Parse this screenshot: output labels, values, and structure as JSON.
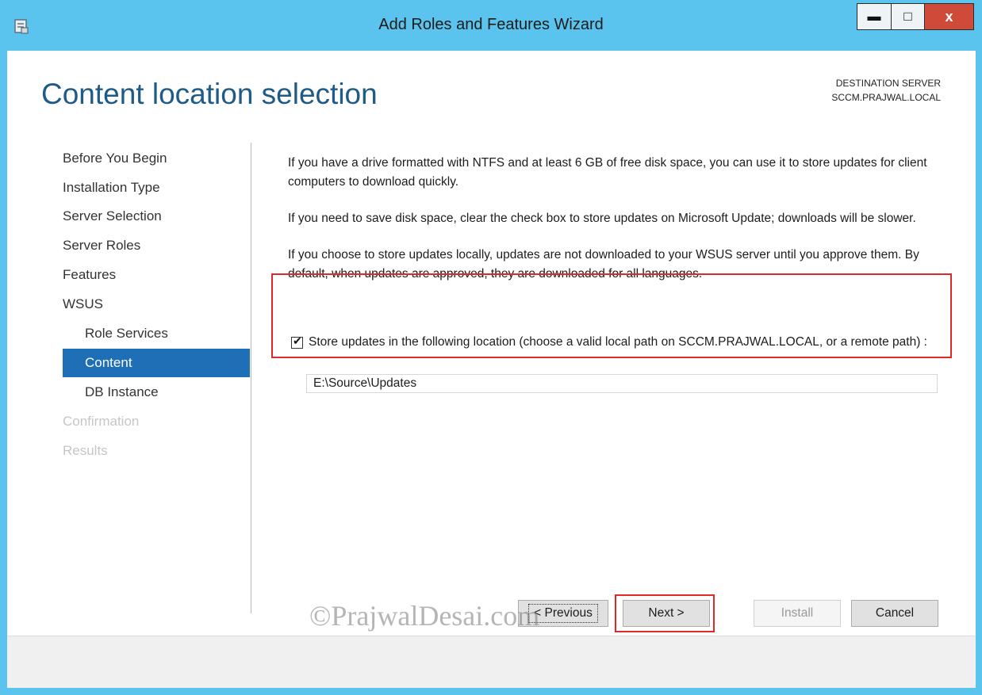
{
  "window": {
    "title": "Add Roles and Features Wizard",
    "icon": "server-manager-icon",
    "minimize_glyph": "▬",
    "maximize_glyph": "□",
    "close_glyph": "x",
    "frame_color": "#5bc4ee",
    "close_color": "#d04a3a"
  },
  "header": {
    "page_title": "Content location selection",
    "destination_label": "DESTINATION SERVER",
    "destination_server": "SCCM.PRAJWAL.LOCAL"
  },
  "nav": {
    "items": [
      {
        "label": "Before You Begin",
        "state": "normal"
      },
      {
        "label": "Installation Type",
        "state": "normal"
      },
      {
        "label": "Server Selection",
        "state": "normal"
      },
      {
        "label": "Server Roles",
        "state": "normal"
      },
      {
        "label": "Features",
        "state": "normal"
      },
      {
        "label": "WSUS",
        "state": "normal"
      },
      {
        "label": "Role Services",
        "state": "sub"
      },
      {
        "label": "Content",
        "state": "selected"
      },
      {
        "label": "DB Instance",
        "state": "sub"
      },
      {
        "label": "Confirmation",
        "state": "disabled"
      },
      {
        "label": "Results",
        "state": "disabled"
      }
    ],
    "selected_color": "#1f6fb6"
  },
  "main": {
    "paragraphs": [
      "If you have a drive formatted with NTFS and at least 6 GB of free disk space, you can use it to store updates for client computers to download quickly.",
      "If you need to save disk space, clear the check box to store updates on Microsoft Update; downloads will be slower.",
      "If you choose to store updates locally, updates are not downloaded to your WSUS server until you approve them. By default, when updates are approved, they are downloaded for all languages."
    ],
    "store_checkbox": {
      "checked": true,
      "label": "Store updates in the following location (choose a valid local path on SCCM.PRAJWAL.LOCAL, or a remote path) :"
    },
    "path_value": "E:\\Source\\Updates"
  },
  "footer": {
    "previous_label": "< Previous",
    "next_label": "Next >",
    "install_label": "Install",
    "cancel_label": "Cancel",
    "watermark": "©PrajwalDesai.com"
  },
  "accent": {
    "title_color": "#1f5b86",
    "highlight_color": "#e02a2a"
  }
}
